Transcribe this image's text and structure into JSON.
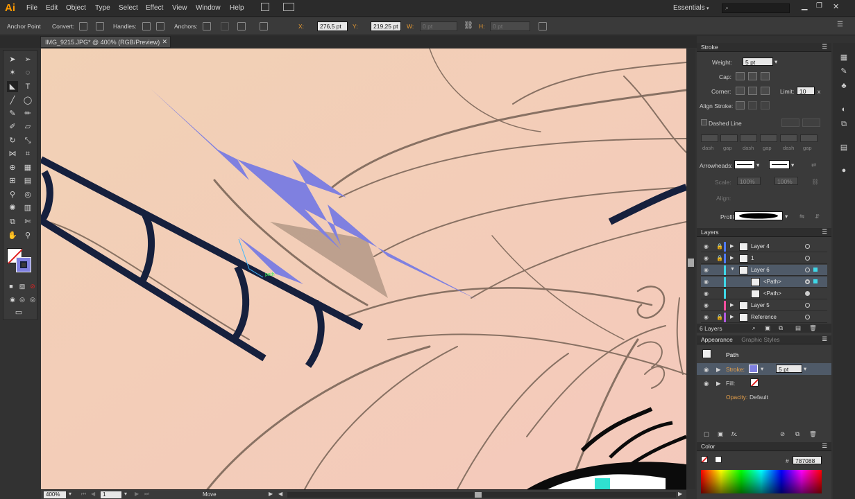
{
  "app": {
    "logo": "Ai",
    "workspace": "Essentials"
  },
  "menu": [
    "File",
    "Edit",
    "Object",
    "Type",
    "Select",
    "Effect",
    "View",
    "Window",
    "Help"
  ],
  "control": {
    "tool_name": "Anchor Point",
    "convert_label": "Convert:",
    "handles_label": "Handles:",
    "anchors_label": "Anchors:",
    "x_label": "X:",
    "x_value": "276,5 pt",
    "y_label": "Y:",
    "y_value": "219,25 pt",
    "w_label": "W:",
    "w_value": "0 pt",
    "h_label": "H:",
    "h_value": "0 pt"
  },
  "document": {
    "tab_title": "IMG_9215.JPG* @ 400% (RGB/Preview)",
    "zoom": "400%",
    "artboard": "1",
    "status_text": "Move",
    "path_hint": "path"
  },
  "stroke_panel": {
    "title": "Stroke",
    "weight_label": "Weight:",
    "weight_value": "5 pt",
    "cap_label": "Cap:",
    "corner_label": "Corner:",
    "limit_label": "Limit:",
    "limit_value": "10",
    "limit_unit": "x",
    "align_label": "Align Stroke:",
    "dashed_label": "Dashed Line",
    "dash_labels": [
      "dash",
      "gap",
      "dash",
      "gap",
      "dash",
      "gap"
    ],
    "arrowheads_label": "Arrowheads:",
    "scale_label": "Scale:",
    "scale_1": "100%",
    "scale_2": "100%",
    "align_arrow_label": "Align:",
    "profile_label": "Profile:"
  },
  "layers_panel": {
    "title": "Layers",
    "count": "6 Layers",
    "rows": [
      {
        "name": "Layer 4",
        "color": "#4f79ff"
      },
      {
        "name": "1",
        "color": "#4f79ff"
      },
      {
        "name": "Layer 6",
        "color": "#3fd8e8"
      },
      {
        "name": "<Path>",
        "color": "#3fd8e8"
      },
      {
        "name": "<Path>",
        "color": "#3fd8e8"
      },
      {
        "name": "Layer 5",
        "color": "#ff4f9e"
      },
      {
        "name": "Reference",
        "color": "#b05be0"
      }
    ]
  },
  "appearance_panel": {
    "tab1": "Appearance",
    "tab2": "Graphic Styles",
    "object": "Path",
    "stroke_label": "Stroke:",
    "stroke_value": "5 pt",
    "fill_label": "Fill:",
    "opacity_label": "Opacity:",
    "opacity_value": "Default"
  },
  "color_panel": {
    "title": "Color",
    "hex_label": "#",
    "hex_value": "787088"
  },
  "colors": {
    "canvas_bg": "#f1cdb6",
    "stroke_navy": "#16203d",
    "lavender": "#7f80e0",
    "selection": "#4f5a68"
  }
}
